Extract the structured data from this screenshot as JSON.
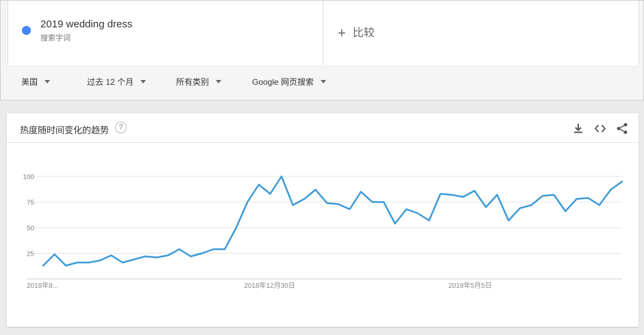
{
  "search_term": {
    "name": "2019 wedding dress",
    "type": "搜索字词",
    "color": "#4285f4"
  },
  "compare": {
    "label": "比较"
  },
  "filters": [
    {
      "label": "美国"
    },
    {
      "label": "过去 12 个月"
    },
    {
      "label": "所有类别"
    },
    {
      "label": "Google 网页搜索"
    }
  ],
  "panel": {
    "title": "热度随时间变化的趋势",
    "icons": [
      "help-icon",
      "download-icon",
      "embed-icon",
      "share-icon"
    ]
  },
  "chart_data": {
    "type": "line",
    "title": "",
    "xlabel": "",
    "ylabel": "",
    "ylim": [
      0,
      100
    ],
    "y_ticks": [
      25,
      50,
      75,
      100
    ],
    "x_ticks": [
      {
        "index": 0,
        "label": "2018年8..."
      },
      {
        "index": 18,
        "label": "2018年12月30日"
      },
      {
        "index": 36,
        "label": "2019年5月5日"
      }
    ],
    "grid": true,
    "color": "#3d9ad7",
    "values": [
      13,
      24,
      13,
      16,
      16,
      18,
      23,
      16,
      19,
      22,
      21,
      23,
      29,
      22,
      25,
      29,
      29,
      50,
      75,
      92,
      83,
      100,
      72,
      78,
      87,
      74,
      73,
      68,
      85,
      75,
      75,
      54,
      68,
      64,
      57,
      83,
      82,
      80,
      86,
      70,
      82,
      57,
      69,
      72,
      81,
      82,
      66,
      78,
      79,
      72,
      87,
      95
    ]
  }
}
